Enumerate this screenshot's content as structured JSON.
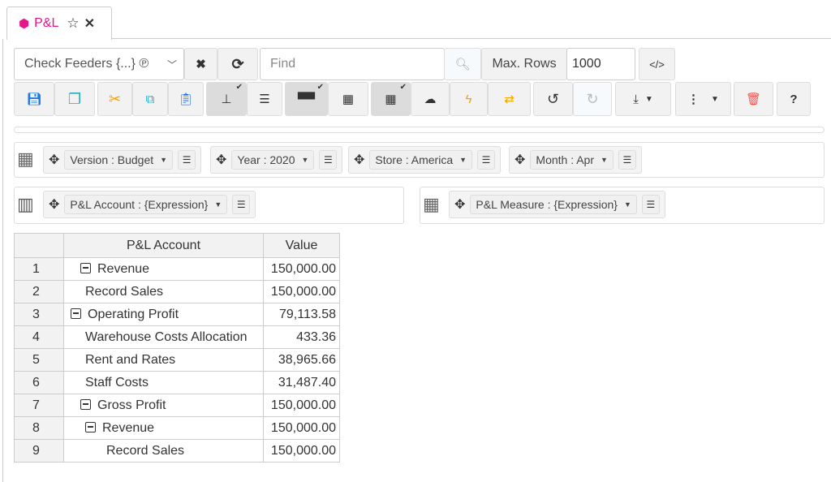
{
  "tab": {
    "title": "P&L",
    "icon": "cube-icon",
    "accent": "#e6168a"
  },
  "toolbar": {
    "subset": "Check Feeders {...} ℗",
    "find_placeholder": "Find",
    "max_rows_label": "Max. Rows",
    "max_rows": "1000"
  },
  "filters": [
    {
      "label": "Version : Budget"
    },
    {
      "label": "Year : 2020"
    },
    {
      "label": "Store : America"
    },
    {
      "label": "Month : Apr"
    }
  ],
  "rows_dim": "P&L Account : {Expression}",
  "cols_dim": "P&L Measure : {Expression}",
  "table": {
    "headers": [
      "P&L Account",
      "Value"
    ],
    "rows": [
      {
        "n": "1",
        "label": "Revenue",
        "indent": 1,
        "collapse": true,
        "value": "150,000.00"
      },
      {
        "n": "2",
        "label": "Record Sales",
        "indent": 3,
        "collapse": false,
        "value": "150,000.00"
      },
      {
        "n": "3",
        "label": "Operating Profit",
        "indent": 0,
        "collapse": true,
        "value": "79,113.58"
      },
      {
        "n": "4",
        "label": "Warehouse Costs Allocation",
        "indent": 2,
        "collapse": false,
        "value": "433.36"
      },
      {
        "n": "5",
        "label": "Rent and Rates",
        "indent": 2,
        "collapse": false,
        "value": "38,965.66"
      },
      {
        "n": "6",
        "label": "Staff Costs",
        "indent": 2,
        "collapse": false,
        "value": "31,487.40"
      },
      {
        "n": "7",
        "label": "Gross Profit",
        "indent": 1,
        "collapse": true,
        "value": "150,000.00"
      },
      {
        "n": "8",
        "label": "Revenue",
        "indent": 2,
        "collapse": true,
        "value": "150,000.00"
      },
      {
        "n": "9",
        "label": "Record Sales",
        "indent": 4,
        "collapse": false,
        "value": "150,000.00"
      }
    ]
  }
}
